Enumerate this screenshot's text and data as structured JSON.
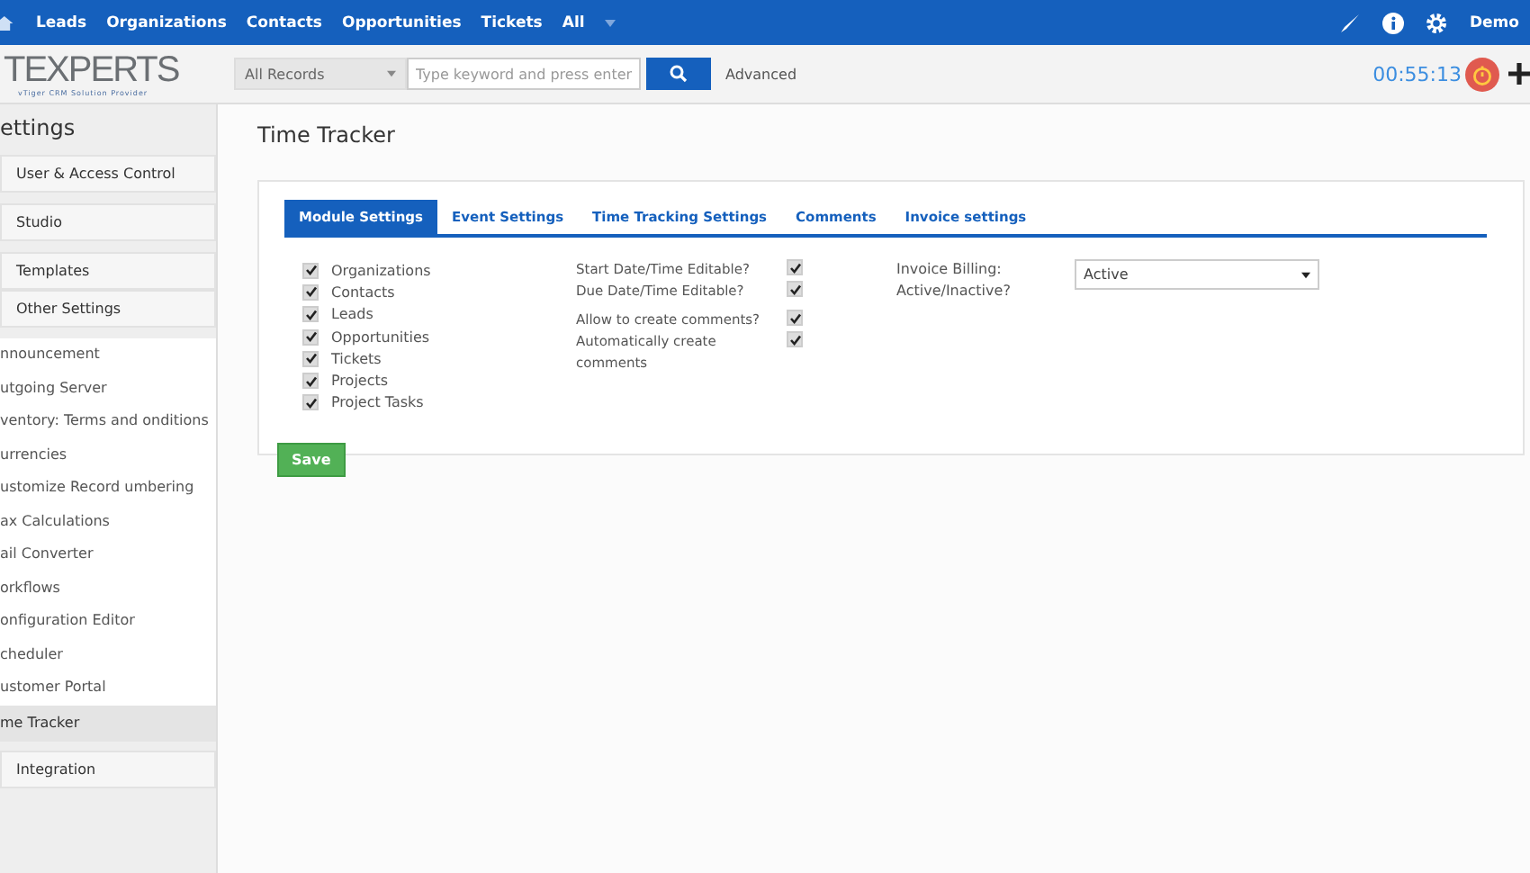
{
  "top_nav": {
    "items": [
      {
        "label": "Leads"
      },
      {
        "label": "Organizations"
      },
      {
        "label": "Contacts"
      },
      {
        "label": "Opportunities"
      },
      {
        "label": "Tickets"
      },
      {
        "label": "All"
      }
    ],
    "user": "Demo"
  },
  "header": {
    "logo": {
      "brand": "TEXPERTS",
      "tagline": "vTiger CRM Solution Provider"
    },
    "search_scope": "All Records",
    "search": {
      "placeholder": "Type keyword and press enter"
    },
    "advanced": "Advanced",
    "timer": "00:55:13"
  },
  "sidebar": {
    "title": "ettings",
    "items": [
      {
        "kind": "group",
        "label": "User & Access Control",
        "selected": false
      },
      {
        "kind": "group",
        "label": "Studio",
        "selected": false
      },
      {
        "kind": "group",
        "label": "Templates",
        "selected": false
      },
      {
        "kind": "group",
        "label": "Other Settings",
        "selected": false
      },
      {
        "kind": "link",
        "label": "nnouncement",
        "selected": false
      },
      {
        "kind": "link",
        "label": "utgoing Server",
        "selected": false
      },
      {
        "kind": "link",
        "label": "ventory: Terms and onditions",
        "selected": false
      },
      {
        "kind": "link",
        "label": "urrencies",
        "selected": false
      },
      {
        "kind": "link",
        "label": "ustomize Record umbering",
        "selected": false
      },
      {
        "kind": "link",
        "label": "ax Calculations",
        "selected": false
      },
      {
        "kind": "link",
        "label": "ail Converter",
        "selected": false
      },
      {
        "kind": "link",
        "label": "orkflows",
        "selected": false
      },
      {
        "kind": "link",
        "label": "onfiguration Editor",
        "selected": false
      },
      {
        "kind": "link",
        "label": "cheduler",
        "selected": false
      },
      {
        "kind": "link",
        "label": "ustomer Portal",
        "selected": false
      },
      {
        "kind": "link",
        "label": "me Tracker",
        "selected": true
      },
      {
        "kind": "group",
        "label": "Integration",
        "selected": false
      }
    ]
  },
  "page_title": "Time Tracker",
  "tabs": [
    {
      "label": "Module Settings",
      "selected": true
    },
    {
      "label": "Event Settings",
      "selected": false
    },
    {
      "label": "Time Tracking Settings",
      "selected": false
    },
    {
      "label": "Comments",
      "selected": false
    },
    {
      "label": "Invoice settings",
      "selected": false
    }
  ],
  "modules": [
    {
      "label": "Organizations",
      "checked": true
    },
    {
      "label": "Contacts",
      "checked": true
    },
    {
      "label": "Leads",
      "checked": true
    },
    {
      "label": "Opportunities",
      "checked": true
    },
    {
      "label": "Tickets",
      "checked": true
    },
    {
      "label": "Projects",
      "checked": true
    },
    {
      "label": "Project Tasks",
      "checked": true
    }
  ],
  "options": [
    {
      "label": "Start Date/Time Editable?",
      "checked": true
    },
    {
      "label": "Due Date/Time Editable?",
      "checked": true
    },
    {
      "label": "Allow to create comments?",
      "checked": true
    },
    {
      "label": "Automatically create comments",
      "checked": true
    }
  ],
  "invoice_billing": {
    "label": "Invoice Billing: Active/Inactive?",
    "value": "Active"
  },
  "save_button": "Save"
}
